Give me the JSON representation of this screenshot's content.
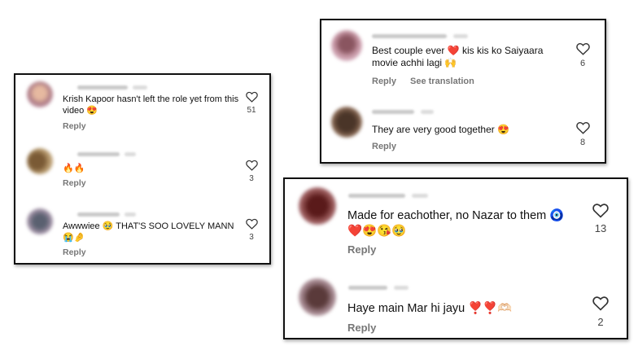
{
  "panel_left": {
    "comments": [
      {
        "text": "Krish Kapoor hasn't left the role yet from this video 😍",
        "reply": "Reply",
        "likes": "51"
      },
      {
        "text": "🔥🔥",
        "reply": "Reply",
        "likes": "3"
      },
      {
        "text": "Awwwiee 🥹 THAT'S SOO LOVELY MANN 😭🤌",
        "reply": "Reply",
        "likes": "3"
      }
    ]
  },
  "panel_top_right": {
    "comments": [
      {
        "text": "Best couple ever ❤️ kis kis ko Saiyaara movie achhi lagi 🙌",
        "reply": "Reply",
        "see_translation": "See translation",
        "likes": "6"
      },
      {
        "text": "They are very good together 😍",
        "reply": "Reply",
        "likes": "8"
      }
    ]
  },
  "panel_bottom_right": {
    "comments": [
      {
        "text": "Made for eachother, no Nazar to them 🧿❤️😍😘🥹",
        "reply": "Reply",
        "likes": "13"
      },
      {
        "text": "Haye main Mar hi jayu ❣️❣️🫶🏻",
        "reply": "Reply",
        "likes": "2"
      }
    ]
  },
  "icons": {
    "like": "heart-outline-icon"
  },
  "colors": {
    "reply": "#777777",
    "text": "#111111",
    "border": "#111111"
  }
}
